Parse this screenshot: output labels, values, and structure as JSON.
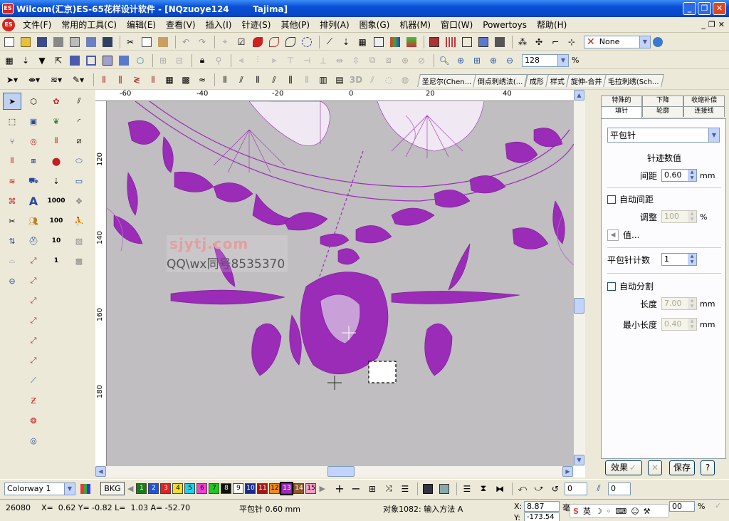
{
  "window": {
    "title": "Wilcom(汇京)ES-65花样设计软件 - [NQzuoye124        Tajima]",
    "logo_text": "ES",
    "buttons": [
      "_",
      "❐",
      "✕"
    ]
  },
  "menubar": {
    "logo_text": "ES",
    "items": [
      "文件(F)",
      "常用的工具(C)",
      "编辑(E)",
      "查看(V)",
      "插入(I)",
      "针迹(S)",
      "其他(P)",
      "排列(A)",
      "图象(G)",
      "机器(M)",
      "窗口(W)",
      "Powertoys",
      "帮助(H)"
    ],
    "mdi_buttons": [
      "_",
      "❐",
      "✕"
    ]
  },
  "toolbar1": {
    "none_combo": "None"
  },
  "toolbar2": {
    "zoom_value": "128",
    "zoom_unit": "%"
  },
  "toolbar3": {
    "label_3d": "3D",
    "tabs": [
      "圣尼尔(Chen...",
      "倒点刺绣法(...",
      "成形",
      "样式",
      "旋伸-合并",
      "毛拉刺绣(Sch..."
    ]
  },
  "ruler": {
    "top_ticks": [
      "-60",
      "-40",
      "-20",
      "0",
      "20",
      "40"
    ],
    "left_ticks": [
      "120",
      "140",
      "160",
      "180"
    ]
  },
  "watermark": {
    "line1": "sjytj.com",
    "line2": "QQ\\wx同号8535370"
  },
  "right_panel": {
    "tabs_row1": [
      "特殊的",
      "下降",
      "收缩补偿"
    ],
    "tabs_row2": [
      "填针",
      "轮廓",
      "连接线"
    ],
    "stitch_type": "平包针",
    "section_title": "针迹数值",
    "spacing_label": "间距",
    "spacing_value": "0.60",
    "spacing_unit": "mm",
    "auto_spacing_label": "自动间距",
    "adjust_label": "调整",
    "adjust_value": "100",
    "adjust_unit": "%",
    "value_button": "值...",
    "count_label": "平包针计数",
    "count_value": "1",
    "auto_split_label": "自动分割",
    "length_label": "长度",
    "length_value": "7.00",
    "length_unit": "mm",
    "min_length_label": "最小长度",
    "min_length_value": "0.40",
    "min_length_unit": "mm",
    "effect_button": "效果",
    "save_button": "保存",
    "help_button": "?"
  },
  "bottom_toolbar": {
    "colorway": "Colorway 1",
    "bkg_button": "BKG",
    "swatches": [
      {
        "label": "1",
        "color": "#1a7a1a",
        "text": "#fff"
      },
      {
        "label": "2",
        "color": "#1f55d8",
        "text": "#fff"
      },
      {
        "label": "3",
        "color": "#e52020",
        "text": "#fff"
      },
      {
        "label": "4",
        "color": "#f0e020",
        "text": "#000"
      },
      {
        "label": "5",
        "color": "#20d0e8",
        "text": "#000"
      },
      {
        "label": "6",
        "color": "#f040d0",
        "text": "#000"
      },
      {
        "label": "7",
        "color": "#20c820",
        "text": "#000"
      },
      {
        "label": "8",
        "color": "#101010",
        "text": "#fff"
      },
      {
        "label": "9",
        "color": "#ffffff",
        "text": "#000"
      },
      {
        "label": "10",
        "color": "#1a2a8a",
        "text": "#fff"
      },
      {
        "label": "11",
        "color": "#a01818",
        "text": "#fff"
      },
      {
        "label": "12",
        "color": "#f08a20",
        "text": "#000"
      },
      {
        "label": "13",
        "color": "#9a2cb8",
        "text": "#fff"
      },
      {
        "label": "14",
        "color": "#8b5a2b",
        "text": "#fff"
      },
      {
        "label": "15",
        "color": "#f3a0c8",
        "text": "#000"
      }
    ],
    "rotate_value": "0",
    "slant_value": "0"
  },
  "statusbar": {
    "stitch_count": "26080",
    "coords": "X=  0.62 Y= -0.82 L=  1.03 A= -52.70",
    "stitch_info": "平包针   0.60 mm",
    "object_info": "对象1082: 输入方法 A",
    "x_label": "X:",
    "x_value": "8.87",
    "y_label": "Y:",
    "y_value": "-173.54",
    "w_label": "毫米",
    "pct1": "00",
    "pct_unit": "%",
    "ime_text": "英"
  },
  "colors": {
    "stitch": "#9a2cb8",
    "canvas": "#c0bec0"
  }
}
